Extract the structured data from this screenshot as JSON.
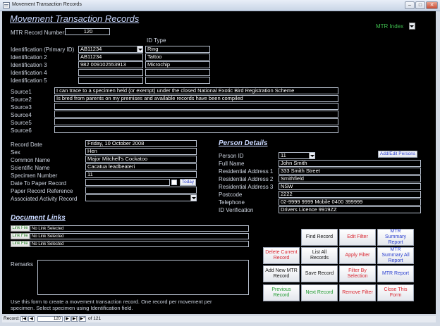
{
  "window": {
    "title": "Movement Transaction Records",
    "minimize": "–",
    "maximize": "□",
    "close": "✕"
  },
  "form_title": "Movement Transaction Records",
  "mtr_index": {
    "label": "MTR Index"
  },
  "mtr_number": {
    "label": "MTR Record Number:",
    "value": "120"
  },
  "id_type_header": "ID Type",
  "identifications": [
    {
      "label": "Identification (Primary ID)",
      "value": "AB11234",
      "type": "Ring"
    },
    {
      "label": "Identification 2",
      "value": "AB11234",
      "type": "Tattoo"
    },
    {
      "label": "Identification 3",
      "value": "982 009102553913",
      "type": "Microchip"
    },
    {
      "label": "Identification 4",
      "value": "",
      "type": ""
    },
    {
      "label": "Identification 5",
      "value": "",
      "type": ""
    }
  ],
  "sources": [
    {
      "label": "Source1",
      "value": "I can trace to a specimen held (or exempt) under the closed National Exotic Bird Registration Scheme"
    },
    {
      "label": "Source2",
      "value": "Is bred from parents on my premises and available records have been compiled"
    },
    {
      "label": "Source3",
      "value": ""
    },
    {
      "label": "Source4",
      "value": ""
    },
    {
      "label": "Source5",
      "value": ""
    },
    {
      "label": "Source6",
      "value": ""
    }
  ],
  "record": {
    "date_label": "Record Date",
    "date": "Friday, 10 October 2008",
    "sex_label": "Sex",
    "sex": "Hen",
    "common_label": "Common Name",
    "common": "Major Mitchell's Cockatoo",
    "scientific_label": "Scientific Name",
    "scientific": "Cacatua leadbeateri",
    "specimen_label": "Specimen Number",
    "specimen": "11",
    "date_paper_label": "Date To Paper Record",
    "date_paper": "",
    "today_button": "Today",
    "paper_ref_label": "Paper Record Reference",
    "paper_ref": "",
    "activity_label": "Associated Activity Record",
    "activity": ""
  },
  "person": {
    "heading": "Person Details",
    "add_edit_button": "Add/Edit Persons",
    "rows": [
      {
        "label": "Person ID",
        "value": "11"
      },
      {
        "label": "Full Name",
        "value": "John Smith"
      },
      {
        "label": "Residential Address 1",
        "value": "333 Smith Street"
      },
      {
        "label": "Residential Address 2",
        "value": "Smithfield"
      },
      {
        "label": "Residential Address 3",
        "value": "NSW"
      },
      {
        "label": "Postcode",
        "value": "2222"
      },
      {
        "label": "Telephone",
        "value": "02-9999 9999 Mobile 0400 399999"
      },
      {
        "label": "ID Verification",
        "value": "Drivers Licence 9919ZZ"
      }
    ]
  },
  "documents": {
    "heading": "Document Links",
    "link_button": "Link File",
    "rows": [
      "No Link Selected",
      "No Link Selected",
      "No Link Selected"
    ]
  },
  "remarks": {
    "label": "Remarks",
    "value": ""
  },
  "help_text": "Use this form to create a movement transaction record. One record per movement per specimen. Select specimen using Identification field.",
  "buttons": {
    "find_record": "Find Record",
    "edit_filter": "Edit Filter",
    "mtr_summary_report": "MTR Summary Report",
    "delete_current": "Delete Current Record",
    "list_all": "List All Records",
    "apply_filter": "Apply Filter",
    "mtr_summary_all": "MTR Summary All Report",
    "add_new_mtr": "Add New MTR Record",
    "save_record": "Save Record",
    "filter_by_selection": "Filter By Selection",
    "mtr_report": "MTR Report",
    "previous_record": "Previous Record",
    "next_record": "Next Record",
    "remove_filter": "Remove Filter",
    "close_form": "Close This Form"
  },
  "status": {
    "record_label": "Record:",
    "first": "|◀",
    "prev": "◀",
    "current": "120",
    "next": "▶",
    "last": "▶|",
    "new": "▶*",
    "of_text": "of 121"
  },
  "colors": {
    "form_bg": "#000000",
    "label_text": "#cfd6e2",
    "heading": "#c9d8ff",
    "index_green": "#3fbf4f"
  }
}
